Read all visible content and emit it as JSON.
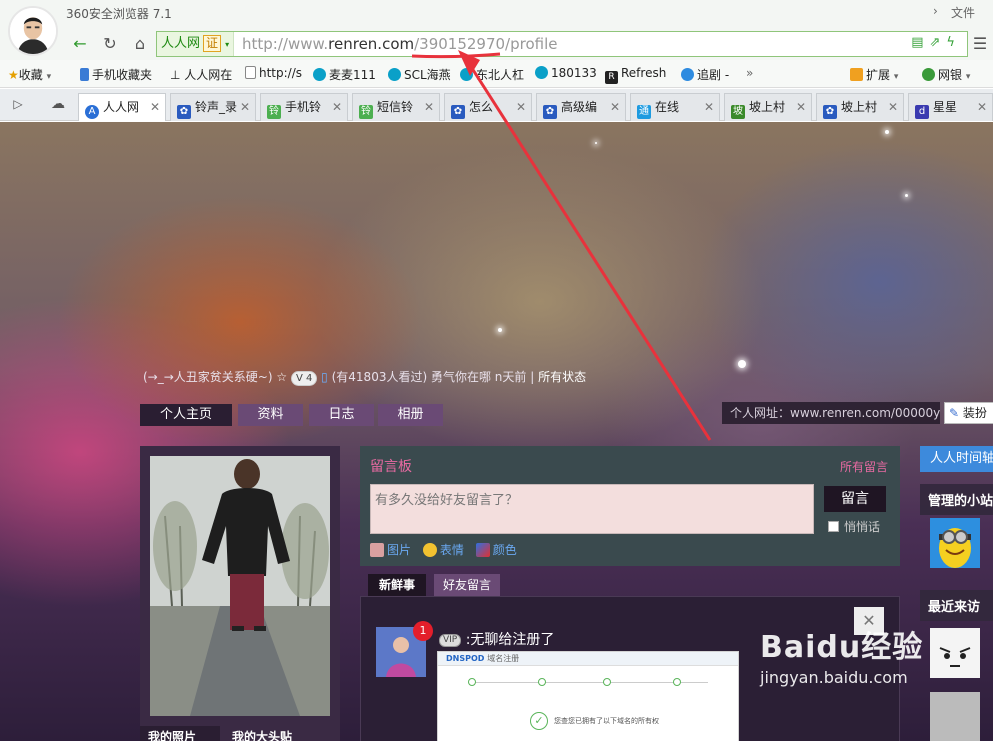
{
  "browser": {
    "app_title": "360安全浏览器 7.1",
    "menu_file": "文件",
    "site_badge": "人人网",
    "cert_label": "证",
    "url_prefix": "http://www.",
    "url_domain": "renren.com",
    "url_path": "/390152970/profile"
  },
  "bookmarks": [
    {
      "label": "收藏",
      "icon": "star-icon",
      "color": "#e5a000"
    },
    {
      "label": "手机收藏夹",
      "icon": "phone-icon",
      "color": "#3a7bd5"
    },
    {
      "label": "人人网在",
      "icon": "anchor-icon",
      "color": "#333333"
    },
    {
      "label": "http://s",
      "icon": "page-icon",
      "color": "#888888"
    },
    {
      "label": "麦麦111",
      "icon": "qq-icon",
      "color": "#0aa0c8"
    },
    {
      "label": "SCL海燕",
      "icon": "qq-icon",
      "color": "#0aa0c8"
    },
    {
      "label": "东北人杠",
      "icon": "qq-icon",
      "color": "#0aa0c8"
    },
    {
      "label": "180133",
      "icon": "qq-icon",
      "color": "#0aa0c8"
    },
    {
      "label": "Refresh",
      "icon": "r-icon",
      "color": "#222222"
    },
    {
      "label": "追剧 -",
      "icon": "heart-icon",
      "color": "#2e8be0"
    }
  ],
  "bookmarks_right": {
    "ext_label": "扩展",
    "bank_label": "网银"
  },
  "tabs": [
    {
      "label": "人人网",
      "color": "#2a6fd6",
      "active": true
    },
    {
      "label": "铃声_录",
      "color": "#2a5bbf"
    },
    {
      "label": "手机铃",
      "color": "#4caf50"
    },
    {
      "label": "短信铃",
      "color": "#4caf50"
    },
    {
      "label": "怎么",
      "color": "#2a5bbf"
    },
    {
      "label": "高级编",
      "color": "#2a5bbf"
    },
    {
      "label": "在线",
      "color": "#1e9be0"
    },
    {
      "label": "坡上村",
      "color": "#3a8a2a"
    },
    {
      "label": "坡上村",
      "color": "#2a5bbf"
    },
    {
      "label": "星星",
      "color": "#3a3ab0"
    }
  ],
  "profile": {
    "status_prefix": "(→_→人丑家贫关系硬~)",
    "vip_label": "V 4",
    "visits": "(有41803人看过)",
    "status_text": "勇气你在哪 n天前",
    "all_status": "所有状态",
    "nav_tabs": [
      "个人主页",
      "资料",
      "日志",
      "相册"
    ],
    "personal_url": "个人网址：www.renren.com/00000y",
    "decorate_label": "装扮",
    "photo_tabs": [
      "我的照片",
      "我的大头贴"
    ]
  },
  "message_board": {
    "title": "留言板",
    "all_messages": "所有留言",
    "placeholder": "有多久没给好友留言了？",
    "submit": "留言",
    "quiet": "悄悄话",
    "tools": [
      "图片",
      "表情",
      "颜色"
    ]
  },
  "feed": {
    "tabs": [
      "新鲜事",
      "好友留言"
    ],
    "badge": "1",
    "text": ":无聊给注册了",
    "img_brand": "DNSPOD",
    "img_title": "域名注册",
    "img_notice": "您查您已拥有了以下域名的所有权"
  },
  "sidebar": {
    "timeline": "人人时间轴",
    "manager": "管理的小站",
    "recent": "最近来访"
  },
  "watermark": {
    "brand": "Baidu经验",
    "site": "jingyan.baidu.com"
  },
  "colors": {
    "annotation": "#e8323c",
    "accent": "#3d8adc"
  }
}
